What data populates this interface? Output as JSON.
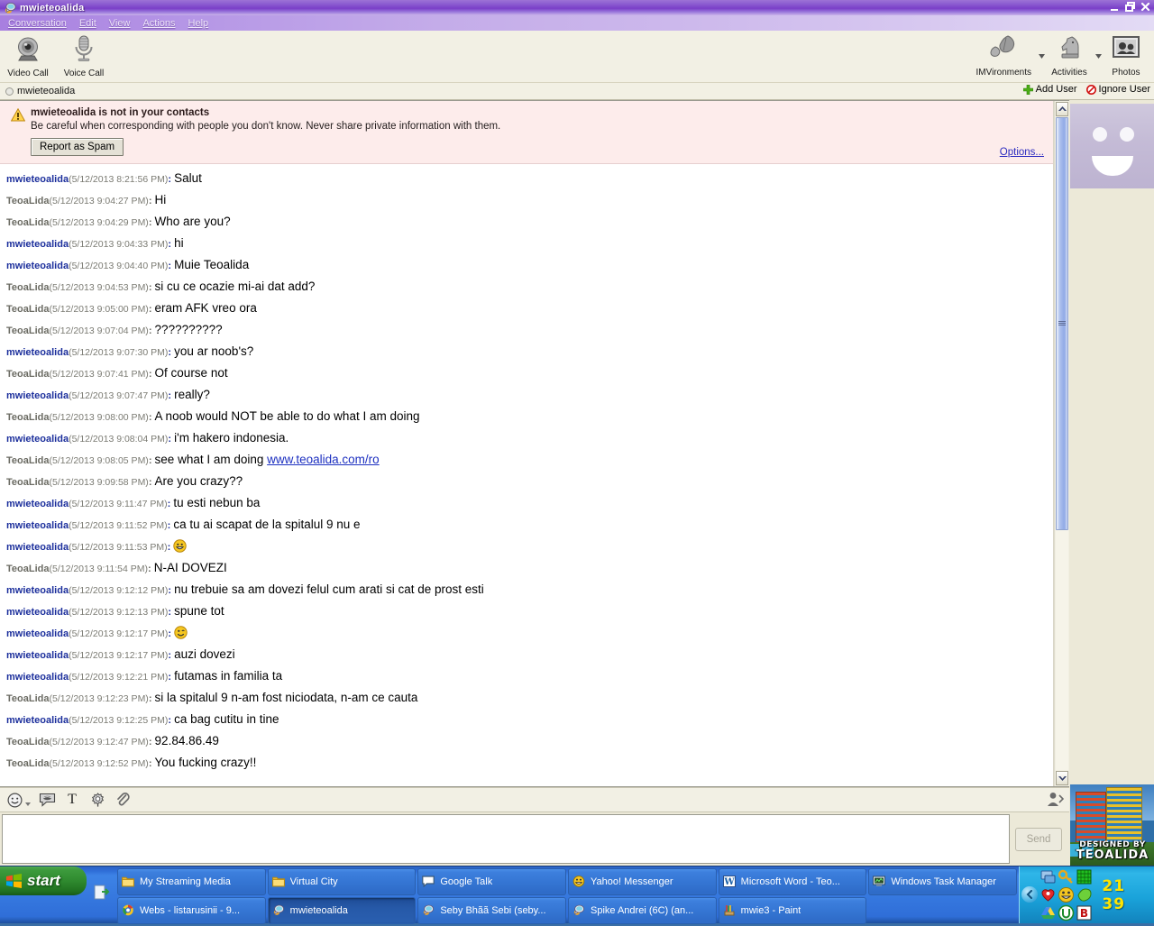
{
  "window": {
    "title": "mwieteoalida",
    "icon": "yahoo-messenger-icon",
    "buttons": {
      "minimize": "minimize-icon",
      "restore": "restore-icon",
      "close": "close-icon"
    }
  },
  "menubar": {
    "items": [
      {
        "label": "Conversation",
        "accel": "C"
      },
      {
        "label": "Edit",
        "accel": "E"
      },
      {
        "label": "View",
        "accel": "V"
      },
      {
        "label": "Actions",
        "accel": "A"
      },
      {
        "label": "Help",
        "accel": "H"
      }
    ]
  },
  "toolbar": {
    "left": [
      {
        "label": "Video Call",
        "icon": "webcam-icon"
      },
      {
        "label": "Voice Call",
        "icon": "microphone-icon"
      }
    ],
    "right": [
      {
        "label": "IMVironments",
        "icon": "leaf-icon",
        "has_caret": true
      },
      {
        "label": "Activities",
        "icon": "chess-knight-icon",
        "has_caret": true
      },
      {
        "label": "Photos",
        "icon": "photos-icon",
        "has_caret": false
      }
    ]
  },
  "userrow": {
    "username": "mwieteoalida",
    "status": "offline-status-dot",
    "add_user": "Add User",
    "ignore_user": "Ignore User"
  },
  "spam_banner": {
    "icon": "warning-icon",
    "title": "mwieteoalida is not in your contacts",
    "description": "Be careful when corresponding with people you don't know. Never share private information with them.",
    "button": "Report as Spam",
    "options_link": "Options..."
  },
  "conversation": {
    "messages": [
      {
        "side": "me",
        "who": "mwieteoalida",
        "ts": "(5/12/2013 8:21:56 PM)",
        "text": "Salut"
      },
      {
        "side": "them",
        "who": "TeoaLida",
        "ts": "(5/12/2013 9:04:27 PM)",
        "text": "Hi"
      },
      {
        "side": "them",
        "who": "TeoaLida",
        "ts": "(5/12/2013 9:04:29 PM)",
        "text": "Who are you?"
      },
      {
        "side": "me",
        "who": "mwieteoalida",
        "ts": "(5/12/2013 9:04:33 PM)",
        "text": "hi"
      },
      {
        "side": "me",
        "who": "mwieteoalida",
        "ts": "(5/12/2013 9:04:40 PM)",
        "text": "Muie Teoalida"
      },
      {
        "side": "them",
        "who": "TeoaLida",
        "ts": "(5/12/2013 9:04:53 PM)",
        "text": "si cu ce ocazie mi-ai dat add?"
      },
      {
        "side": "them",
        "who": "TeoaLida",
        "ts": "(5/12/2013 9:05:00 PM)",
        "text": "eram AFK vreo ora"
      },
      {
        "side": "them",
        "who": "TeoaLida",
        "ts": "(5/12/2013 9:07:04 PM)",
        "text": "??????????"
      },
      {
        "side": "me",
        "who": "mwieteoalida",
        "ts": "(5/12/2013 9:07:30 PM)",
        "text": "you ar noob's?"
      },
      {
        "side": "them",
        "who": "TeoaLida",
        "ts": "(5/12/2013 9:07:41 PM)",
        "text": "Of course not"
      },
      {
        "side": "me",
        "who": "mwieteoalida",
        "ts": "(5/12/2013 9:07:47 PM)",
        "text": "really?"
      },
      {
        "side": "them",
        "who": "TeoaLida",
        "ts": "(5/12/2013 9:08:00 PM)",
        "text": "A noob would NOT be able to do what I am doing"
      },
      {
        "side": "me",
        "who": "mwieteoalida",
        "ts": "(5/12/2013 9:08:04 PM)",
        "text": "i'm hakero indonesia."
      },
      {
        "side": "them",
        "who": "TeoaLida",
        "ts": "(5/12/2013 9:08:05 PM)",
        "text": "see what I am doing ",
        "link": "www.teoalida.com/ro"
      },
      {
        "side": "them",
        "who": "TeoaLida",
        "ts": "(5/12/2013 9:09:58 PM)",
        "text": "Are you crazy??"
      },
      {
        "side": "me",
        "who": "mwieteoalida",
        "ts": "(5/12/2013 9:11:47 PM)",
        "text": "tu esti nebun ba"
      },
      {
        "side": "me",
        "who": "mwieteoalida",
        "ts": "(5/12/2013 9:11:52 PM)",
        "text": "ca tu ai scapat de la spitalul 9 nu e"
      },
      {
        "side": "me",
        "who": "mwieteoalida",
        "ts": "(5/12/2013 9:11:53 PM)",
        "text": "",
        "emoticon": "smiley-happy-icon"
      },
      {
        "side": "them",
        "who": "TeoaLida",
        "ts": "(5/12/2013 9:11:54 PM)",
        "text": "N-AI DOVEZI"
      },
      {
        "side": "me",
        "who": "mwieteoalida",
        "ts": "(5/12/2013 9:12:12 PM)",
        "text": "nu trebuie sa am dovezi felul  cum arati si cat de prost esti"
      },
      {
        "side": "me",
        "who": "mwieteoalida",
        "ts": "(5/12/2013 9:12:13 PM)",
        "text": "spune tot"
      },
      {
        "side": "me",
        "who": "mwieteoalida",
        "ts": "(5/12/2013 9:12:17 PM)",
        "text": "",
        "emoticon": "smiley-wink-icon"
      },
      {
        "side": "me",
        "who": "mwieteoalida",
        "ts": "(5/12/2013 9:12:17 PM)",
        "text": "auzi dovezi"
      },
      {
        "side": "me",
        "who": "mwieteoalida",
        "ts": "(5/12/2013 9:12:21 PM)",
        "text": "futamas in familia ta"
      },
      {
        "side": "them",
        "who": "TeoaLida",
        "ts": "(5/12/2013 9:12:23 PM)",
        "text": "si la spitalul 9 n-am fost niciodata, n-am ce cauta"
      },
      {
        "side": "me",
        "who": "mwieteoalida",
        "ts": "(5/12/2013 9:12:25 PM)",
        "text": "ca bag cutitu in tine"
      },
      {
        "side": "them",
        "who": "TeoaLida",
        "ts": "(5/12/2013 9:12:47 PM)",
        "text": "92.84.86.49"
      },
      {
        "side": "them",
        "who": "TeoaLida",
        "ts": "(5/12/2013 9:12:52 PM)",
        "text": "You fucking crazy!!"
      }
    ]
  },
  "format_bar": {
    "buttons": [
      {
        "icon": "emoticon-icon",
        "has_caret": true
      },
      {
        "icon": "buzz-icon",
        "has_caret": false
      },
      {
        "icon": "text-font-icon",
        "has_caret": false
      },
      {
        "icon": "settings-gear-icon",
        "has_caret": false
      },
      {
        "icon": "attachment-paperclip-icon",
        "has_caret": false
      }
    ],
    "right_icon": "contact-card-icon"
  },
  "input": {
    "value": "",
    "placeholder": "",
    "send_label": "Send"
  },
  "right_panel": {
    "avatar": "smiley-avatar-icon",
    "promo": {
      "line1": "DESIGNED BY",
      "line2": "TEOALIDA"
    }
  },
  "taskbar": {
    "start_label": "start",
    "quick_launch": [
      {
        "icon": "show-desktop-icon"
      }
    ],
    "items": [
      {
        "label": "My Streaming Media",
        "icon": "folder-icon",
        "active": false
      },
      {
        "label": "Virtual City",
        "icon": "folder-icon",
        "active": false
      },
      {
        "label": "Google Talk",
        "icon": "gtalk-icon",
        "active": false
      },
      {
        "label": "Yahoo! Messenger",
        "icon": "yahoo-icon",
        "active": false
      },
      {
        "label": "Microsoft Word - Teo...",
        "icon": "word-icon",
        "active": false
      },
      {
        "label": "Windows Task Manager",
        "icon": "taskmanager-icon",
        "active": false
      },
      {
        "label": "Webs - listarusinii - 9...",
        "icon": "chrome-icon",
        "active": false
      },
      {
        "label": "mwieteoalida",
        "icon": "yahoo-im-icon",
        "active": true
      },
      {
        "label": "Seby Bhãã Sebi (seby...",
        "icon": "yahoo-im-icon",
        "active": false
      },
      {
        "label": "Spike Andrei (6C) (an...",
        "icon": "yahoo-im-icon",
        "active": false
      },
      {
        "label": "mwie3 - Paint",
        "icon": "paint-icon",
        "active": false
      }
    ],
    "tray": {
      "expand_icon": "tray-expand-icon",
      "icons": [
        "network-icon",
        "security-key-icon",
        "green-grid-icon",
        "messenger-heart-icon",
        "yahoo-smiley-icon",
        "green-check-icon",
        "google-drive-icon",
        "utorrent-icon",
        "b-red-icon"
      ],
      "clock": "21 39"
    }
  }
}
